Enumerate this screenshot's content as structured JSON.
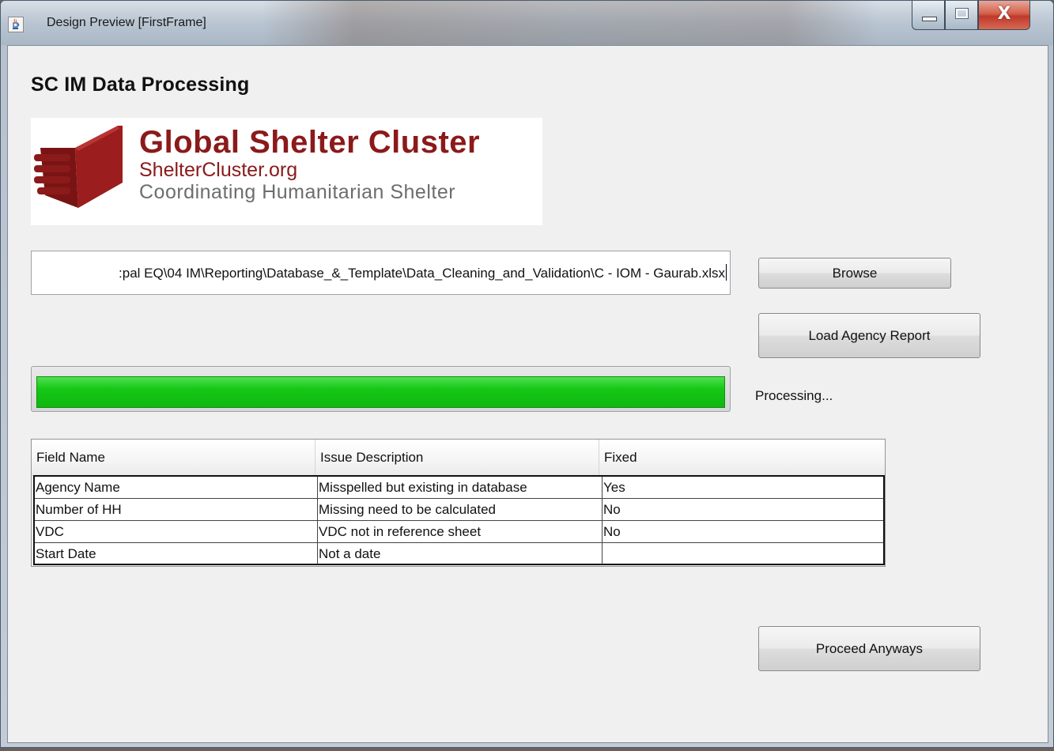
{
  "window": {
    "title": "Design Preview [FirstFrame]",
    "app_icon": "java-cup-icon",
    "caption_close": "X"
  },
  "main": {
    "heading": "SC IM Data Processing",
    "logo": {
      "line1": "Global Shelter Cluster",
      "line2": "ShelterCluster.org",
      "line3": "Coordinating Humanitarian Shelter",
      "brand_color": "#8b1a1a"
    },
    "file_path": {
      "value": ":pal EQ\\04 IM\\Reporting\\Database_&_Template\\Data_Cleaning_and_Validation\\C - IOM - Gaurab.xlsx"
    },
    "browse_label": "Browse",
    "load_label": "Load Agency Report",
    "progress": {
      "fraction": 1.0,
      "color": "#16c716"
    },
    "status_text": "Processing...",
    "table": {
      "columns": [
        "Field Name",
        "Issue Description",
        "Fixed"
      ],
      "rows": [
        [
          "Agency Name",
          "Misspelled but existing in database",
          "Yes"
        ],
        [
          "Number of HH",
          "Missing need to be calculated",
          "No"
        ],
        [
          "VDC",
          "VDC not in reference sheet",
          "No"
        ],
        [
          "Start Date",
          "Not a date",
          ""
        ]
      ]
    },
    "proceed_label": "Proceed Anyways"
  }
}
